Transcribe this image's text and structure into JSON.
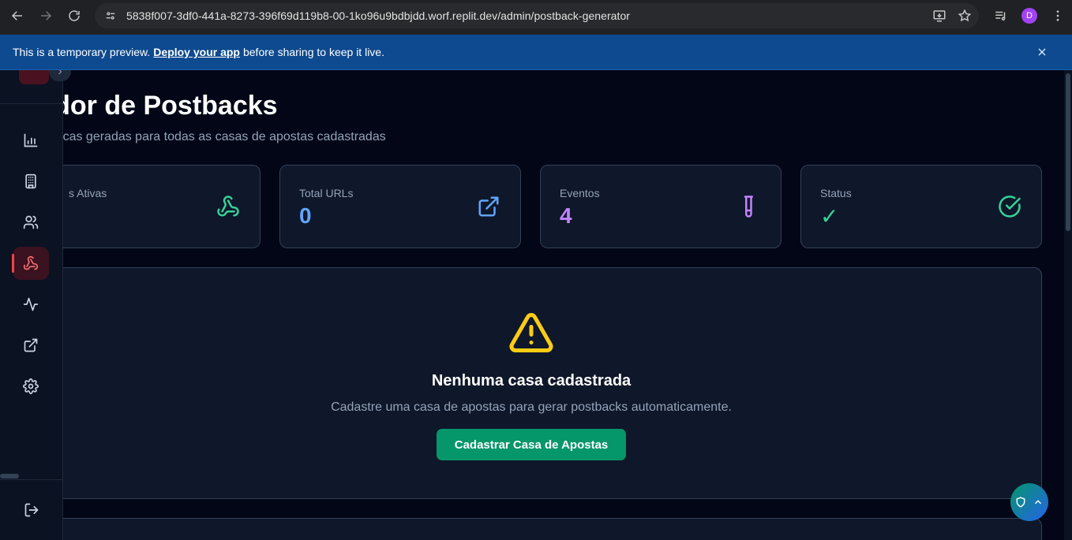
{
  "browser": {
    "url": "5838f007-3df0-441a-8273-396f69d119b8-00-1ko96u9bdbjdd.worf.replit.dev/admin/postback-generator",
    "avatar_letter": "D"
  },
  "banner": {
    "text_before": "This is a temporary preview.",
    "link": "Deploy your app",
    "text_after": "before sharing to keep it live."
  },
  "sidebar": {
    "items": [
      {
        "icon": "bar-chart-icon",
        "active": false
      },
      {
        "icon": "building-icon",
        "active": false
      },
      {
        "icon": "users-icon",
        "active": false
      },
      {
        "icon": "webhook-icon",
        "active": true
      },
      {
        "icon": "activity-icon",
        "active": false
      },
      {
        "icon": "external-link-icon",
        "active": false
      },
      {
        "icon": "settings-icon",
        "active": false
      }
    ],
    "logout_icon": "logout-icon"
  },
  "page": {
    "title": "rador de Postbacks",
    "subtitle": "tomáticas geradas para todas as casas de apostas cadastradas"
  },
  "stats": [
    {
      "label": "s Ativas",
      "value": "",
      "color": "#34d399",
      "icon": "webhook-icon"
    },
    {
      "label": "Total URLs",
      "value": "0",
      "color": "#60a5fa",
      "icon": "external-link-icon"
    },
    {
      "label": "Eventos",
      "value": "4",
      "color": "#c084fc",
      "icon": "test-tube-icon"
    },
    {
      "label": "Status",
      "value": "✓",
      "color": "#34d399",
      "icon": "check-circle-icon"
    }
  ],
  "empty_state": {
    "title": "Nenhuma casa cadastrada",
    "description": "Cadastre uma casa de apostas para gerar postbacks automaticamente.",
    "button": "Cadastrar Casa de Apostas",
    "warning_color": "#facc15"
  }
}
